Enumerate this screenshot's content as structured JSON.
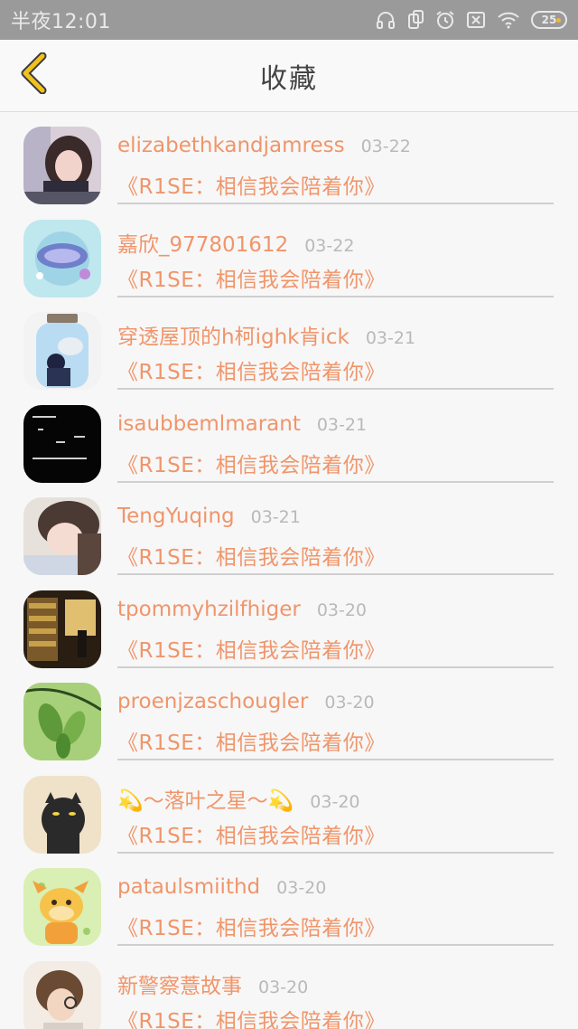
{
  "status_bar": {
    "time": "半夜12:01",
    "battery": "25",
    "icons": [
      "headphones-icon",
      "screen-rotate-icon",
      "alarm-icon",
      "sim-off-icon",
      "wifi-icon"
    ]
  },
  "nav": {
    "back_icon": "chevron-left-icon",
    "title": "收藏"
  },
  "colors": {
    "accent": "#f0956a",
    "back_chevron": "#f2c21b",
    "date": "#b9b9b9"
  },
  "favorites": [
    {
      "name": "elizabethkandjamress",
      "date": "03-22",
      "title": "《R1SE：相信我会陪着你》",
      "avatar": "girl-photo"
    },
    {
      "name": "嘉欣_977801612",
      "date": "03-22",
      "title": "《R1SE：相信我会陪着你》",
      "avatar": "blue-badge"
    },
    {
      "name": "穿透屋顶的h柯ighk肯ick",
      "date": "03-21",
      "title": "《R1SE：相信我会陪着你》",
      "avatar": "jar-illustration"
    },
    {
      "name": "isaubbemlmarant",
      "date": "03-21",
      "title": "《R1SE：相信我会陪着你》",
      "avatar": "black-text-image"
    },
    {
      "name": "TengYuqing",
      "date": "03-21",
      "title": "《R1SE：相信我会陪着你》",
      "avatar": "girl-portrait"
    },
    {
      "name": "tpommyhzilfhiger",
      "date": "03-20",
      "title": "《R1SE：相信我会陪着你》",
      "avatar": "bookstore-photo"
    },
    {
      "name": "proenjzaschougler",
      "date": "03-20",
      "title": "《R1SE：相信我会陪着你》",
      "avatar": "green-leaves"
    },
    {
      "name": "💫～落叶之星～💫",
      "date": "03-20",
      "title": "《R1SE：相信我会陪着你》",
      "avatar": "black-cat"
    },
    {
      "name": "pataulsmiithd",
      "date": "03-20",
      "title": "《R1SE：相信我会陪着你》",
      "avatar": "cartoon-cow"
    },
    {
      "name": "新警察薏故事",
      "date": "03-20",
      "title": "《R1SE：相信我会陪着你》",
      "avatar": "boy-glasses"
    }
  ]
}
